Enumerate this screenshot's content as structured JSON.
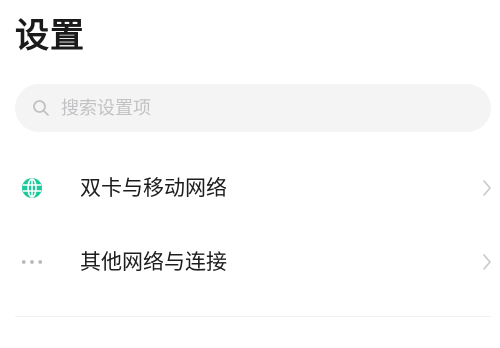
{
  "header": {
    "title": "设置"
  },
  "search": {
    "placeholder": "搜索设置项",
    "value": ""
  },
  "list": {
    "items": [
      {
        "label": "双卡与移动网络",
        "icon": "globe-icon",
        "icon_color": "#1ec99b"
      },
      {
        "label": "其他网络与连接",
        "icon": "more-dots-icon",
        "icon_color": "#b9b9b9"
      }
    ]
  },
  "colors": {
    "accent": "#1ec99b",
    "chevron": "#c8c8c8",
    "search_bg": "#f4f4f5",
    "placeholder": "#c2c2c4"
  }
}
